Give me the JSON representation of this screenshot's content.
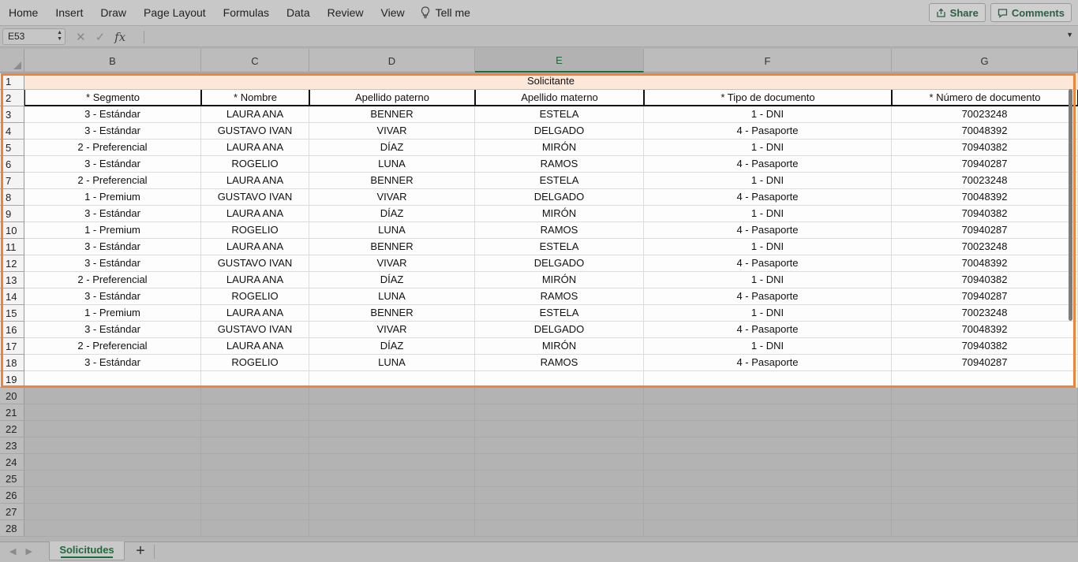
{
  "ribbon": {
    "menu": [
      "Home",
      "Insert",
      "Draw",
      "Page Layout",
      "Formulas",
      "Data",
      "Review",
      "View"
    ],
    "tell_me": "Tell me",
    "share": "Share",
    "comments": "Comments"
  },
  "formula_bar": {
    "name_box": "E53",
    "fx": "fx",
    "formula": ""
  },
  "columns": [
    "B",
    "C",
    "D",
    "E",
    "F",
    "G"
  ],
  "selected_column": "E",
  "row_numbers": [
    "1",
    "2",
    "3",
    "4",
    "5",
    "6",
    "7",
    "8",
    "9",
    "10",
    "11",
    "12",
    "13",
    "14",
    "15",
    "16",
    "17",
    "18",
    "19",
    "20",
    "21",
    "22",
    "23",
    "24",
    "25",
    "26",
    "27",
    "28"
  ],
  "table": {
    "group_header": "Solicitante",
    "headers": [
      "* Segmento",
      "* Nombre",
      "Apellido paterno",
      "Apellido materno",
      "* Tipo de documento",
      "* Número de documento"
    ],
    "rows": [
      [
        "3 - Estándar",
        "LAURA ANA",
        "BENNER",
        "ESTELA",
        "1 - DNI",
        "70023248"
      ],
      [
        "3 - Estándar",
        "GUSTAVO IVAN",
        "VIVAR",
        "DELGADO",
        "4 - Pasaporte",
        "70048392"
      ],
      [
        "2 - Preferencial",
        "LAURA ANA",
        "DÍAZ",
        "MIRÓN",
        "1 - DNI",
        "70940382"
      ],
      [
        "3 - Estándar",
        "ROGELIO",
        "LUNA",
        "RAMOS",
        "4 - Pasaporte",
        "70940287"
      ],
      [
        "2 - Preferencial",
        "LAURA ANA",
        "BENNER",
        "ESTELA",
        "1 - DNI",
        "70023248"
      ],
      [
        "1 - Premium",
        "GUSTAVO IVAN",
        "VIVAR",
        "DELGADO",
        "4 - Pasaporte",
        "70048392"
      ],
      [
        "3 - Estándar",
        "LAURA ANA",
        "DÍAZ",
        "MIRÓN",
        "1 - DNI",
        "70940382"
      ],
      [
        "1 - Premium",
        "ROGELIO",
        "LUNA",
        "RAMOS",
        "4 - Pasaporte",
        "70940287"
      ],
      [
        "3 - Estándar",
        "LAURA ANA",
        "BENNER",
        "ESTELA",
        "1 - DNI",
        "70023248"
      ],
      [
        "3 - Estándar",
        "GUSTAVO IVAN",
        "VIVAR",
        "DELGADO",
        "4 - Pasaporte",
        "70048392"
      ],
      [
        "2 - Preferencial",
        "LAURA ANA",
        "DÍAZ",
        "MIRÓN",
        "1 - DNI",
        "70940382"
      ],
      [
        "3 - Estándar",
        "ROGELIO",
        "LUNA",
        "RAMOS",
        "4 - Pasaporte",
        "70940287"
      ],
      [
        "1 - Premium",
        "LAURA ANA",
        "BENNER",
        "ESTELA",
        "1 - DNI",
        "70023248"
      ],
      [
        "3 - Estándar",
        "GUSTAVO IVAN",
        "VIVAR",
        "DELGADO",
        "4 - Pasaporte",
        "70048392"
      ],
      [
        "2 - Preferencial",
        "LAURA ANA",
        "DÍAZ",
        "MIRÓN",
        "1 - DNI",
        "70940382"
      ],
      [
        "3 - Estándar",
        "ROGELIO",
        "LUNA",
        "RAMOS",
        "4 - Pasaporte",
        "70940287"
      ]
    ]
  },
  "sheet_tabs": {
    "active": "Solicitudes",
    "add": "+"
  },
  "colors": {
    "accent_green": "#1e6b3c",
    "highlight_orange": "#f0833a",
    "header_fill": "#fde7d9"
  }
}
